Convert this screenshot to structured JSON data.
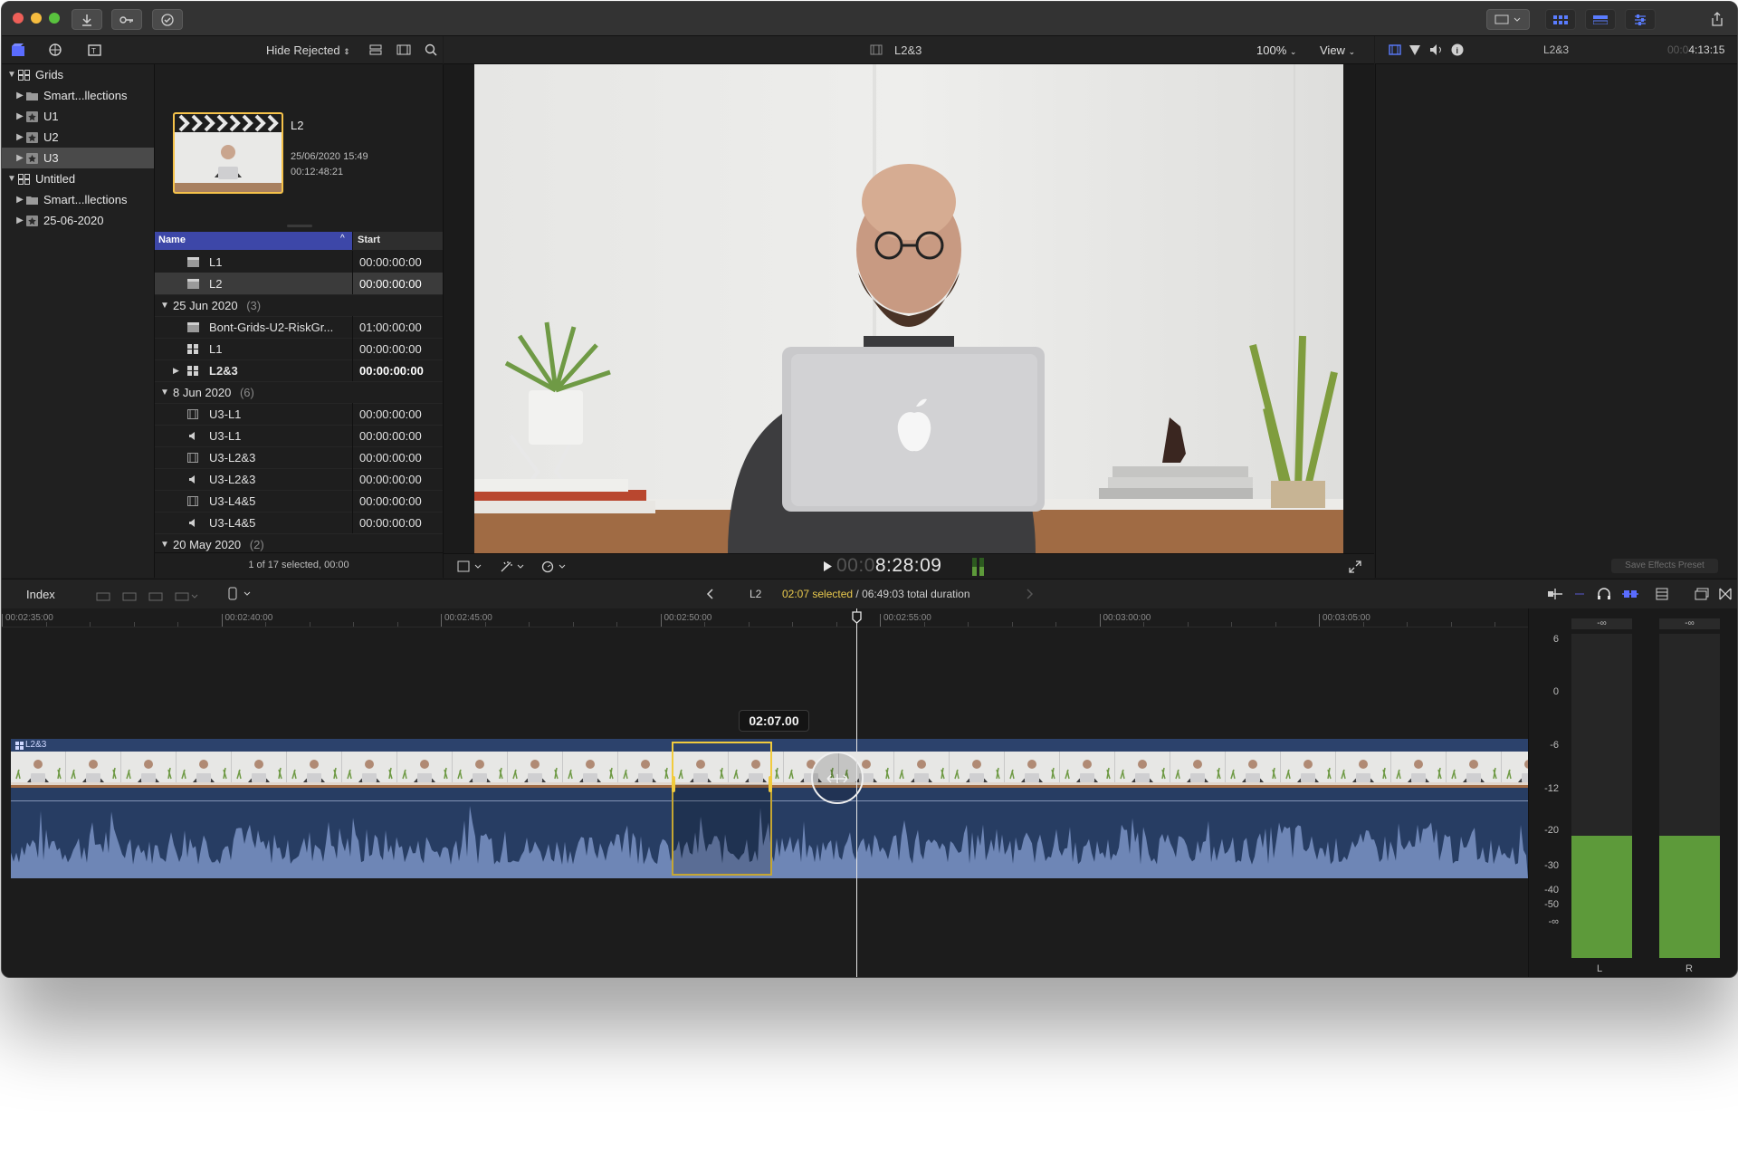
{
  "toolbar": {
    "icons": [
      "import-icon",
      "keyword-icon",
      "checkmark-icon"
    ]
  },
  "library": {
    "hide_rejected": "Hide Rejected",
    "items": [
      {
        "label": "Grids",
        "level": 0,
        "expanded": true,
        "icon": "library-icon"
      },
      {
        "label": "Smart...llections",
        "level": 1,
        "icon": "folder-icon"
      },
      {
        "label": "U1",
        "level": 1,
        "icon": "event-icon"
      },
      {
        "label": "U2",
        "level": 1,
        "icon": "event-icon"
      },
      {
        "label": "U3",
        "level": 1,
        "icon": "event-icon",
        "selected": true
      },
      {
        "label": "Untitled",
        "level": 0,
        "expanded": true,
        "icon": "library-icon"
      },
      {
        "label": "Smart...llections",
        "level": 1,
        "icon": "folder-icon"
      },
      {
        "label": "25-06-2020",
        "level": 1,
        "icon": "event-icon"
      }
    ]
  },
  "clip_info": {
    "name": "L2",
    "date": "25/06/2020 15:49",
    "duration": "00:12:48:21"
  },
  "browser": {
    "col_name": "Name",
    "col_start": "Start",
    "rows": [
      {
        "name": "L1",
        "start": "00:00:00:00",
        "type": "clip"
      },
      {
        "name": "L2",
        "start": "00:00:00:00",
        "type": "clip",
        "selected": true
      },
      {
        "name": "25 Jun 2020",
        "count": "(3)",
        "type": "group"
      },
      {
        "name": "Bont-Grids-U2-RiskGr...",
        "start": "01:00:00:00",
        "type": "clip"
      },
      {
        "name": "L1",
        "start": "00:00:00:00",
        "type": "multicam"
      },
      {
        "name": "L2&3",
        "start": "00:00:00:00",
        "type": "multicam",
        "bold": true
      },
      {
        "name": "8 Jun 2020",
        "count": "(6)",
        "type": "group"
      },
      {
        "name": "U3-L1",
        "start": "00:00:00:00",
        "type": "video"
      },
      {
        "name": "U3-L1",
        "start": "00:00:00:00",
        "type": "audio"
      },
      {
        "name": "U3-L2&3",
        "start": "00:00:00:00",
        "type": "video"
      },
      {
        "name": "U3-L2&3",
        "start": "00:00:00:00",
        "type": "audio"
      },
      {
        "name": "U3-L4&5",
        "start": "00:00:00:00",
        "type": "video"
      },
      {
        "name": "U3-L4&5",
        "start": "00:00:00:00",
        "type": "audio"
      },
      {
        "name": "20 May 2020",
        "count": "(2)",
        "type": "group"
      }
    ],
    "status": "1 of 17 selected, 00:00"
  },
  "viewer": {
    "title": "L2&3",
    "zoom": "100%",
    "view": "View",
    "timecode_dim": "00:0",
    "timecode": "8:28:09"
  },
  "inspector": {
    "title": "L2&3",
    "timecode_dim": "00:0",
    "timecode": "4:13:15",
    "save_preset": "Save Effects Preset"
  },
  "timeline": {
    "index": "Index",
    "clip_name": "L2",
    "selected": "02:07 selected",
    "total": " / 06:49:03 total duration",
    "tooltip": "02:07.00",
    "track_label": "L2&3",
    "ruler": [
      "00:02:35:00",
      "00:02:40:00",
      "00:02:45:00",
      "00:02:50:00",
      "00:02:55:00",
      "00:03:00:00",
      "00:03:05:00"
    ]
  },
  "meters": {
    "peak_l": "-∞",
    "peak_r": "-∞",
    "scale": [
      "6",
      "0",
      "-6",
      "-12",
      "-20",
      "-30",
      "-40",
      "-50",
      "-∞"
    ],
    "channel_l": "L",
    "channel_r": "R",
    "level_l": 0.22,
    "level_r": 0.22,
    "color": "#5d9a3a"
  },
  "colors": {
    "accent": "#5a6cff",
    "selection": "#f5d34a",
    "track": "#2d4468"
  }
}
